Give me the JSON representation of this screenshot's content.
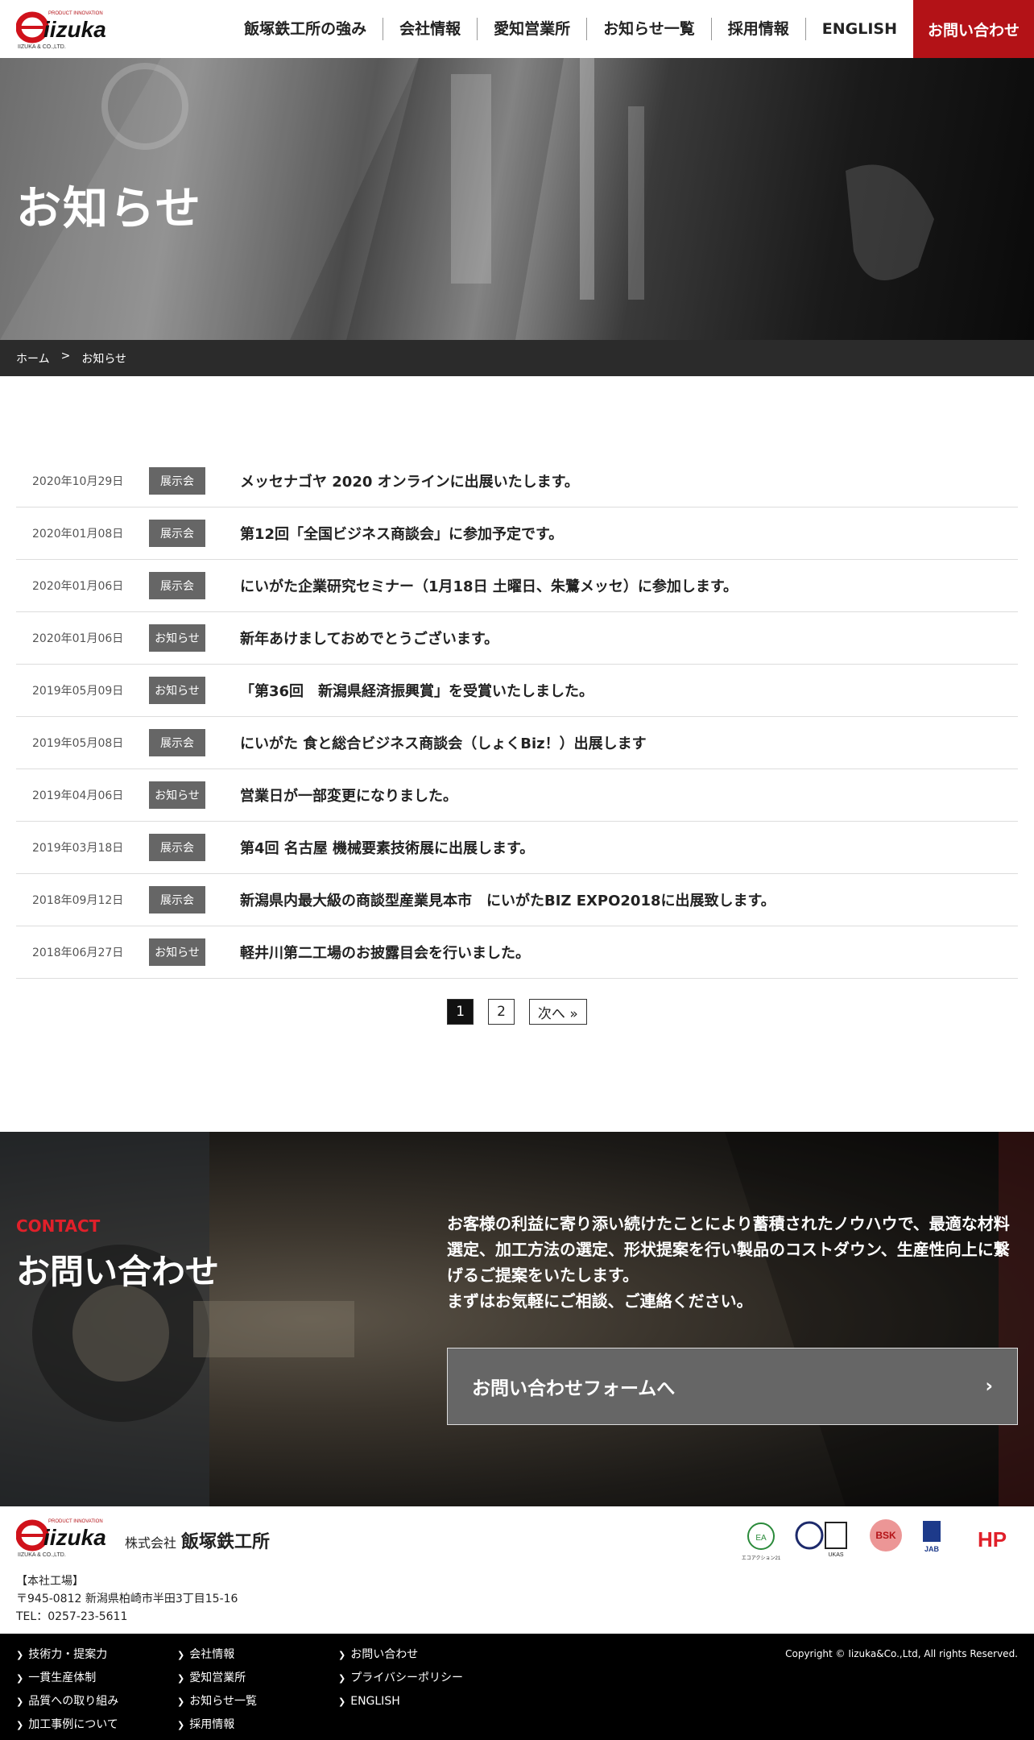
{
  "header": {
    "logo_tagline": "PRODUCT INNOVATION",
    "logo_word": "iizuka",
    "logo_sub": "IIZUKA & CO.,LTD.",
    "nav": [
      "飯塚鉄工所の強み",
      "会社情報",
      "愛知営業所",
      "お知らせ一覧",
      "採用情報",
      "ENGLISH"
    ],
    "contact": "お問い合わせ"
  },
  "hero": {
    "title": "お知らせ"
  },
  "breadcrumb": {
    "home": "ホーム",
    "sep": ">",
    "current": "お知らせ"
  },
  "news": [
    {
      "date": "2020年10月29日",
      "cat": "展示会",
      "title": "メッセナゴヤ 2020 オンラインに出展いたします。"
    },
    {
      "date": "2020年01月08日",
      "cat": "展示会",
      "title": "第12回「全国ビジネス商談会」に参加予定です。"
    },
    {
      "date": "2020年01月06日",
      "cat": "展示会",
      "title": "にいがた企業研究セミナー（1月18日 土曜日、朱鷺メッセ）に参加します。"
    },
    {
      "date": "2020年01月06日",
      "cat": "お知らせ",
      "title": "新年あけましておめでとうございます。"
    },
    {
      "date": "2019年05月09日",
      "cat": "お知らせ",
      "title": "「第36回　新潟県経済振興賞」を受賞いたしました。"
    },
    {
      "date": "2019年05月08日",
      "cat": "展示会",
      "title": "にいがた 食と総合ビジネス商談会（しょくBiz！）出展します"
    },
    {
      "date": "2019年04月06日",
      "cat": "お知らせ",
      "title": "営業日が一部変更になりました。"
    },
    {
      "date": "2019年03月18日",
      "cat": "展示会",
      "title": "第4回 名古屋 機械要素技術展に出展します。"
    },
    {
      "date": "2018年09月12日",
      "cat": "展示会",
      "title": "新潟県内最大級の商談型産業見本市　にいがたBIZ EXPO2018に出展致します。"
    },
    {
      "date": "2018年06月27日",
      "cat": "お知らせ",
      "title": "軽井川第二工場のお披露目会を行いました。"
    }
  ],
  "pager": {
    "current": "1",
    "page2": "2",
    "next": "次へ »"
  },
  "contact": {
    "label": "CONTACT",
    "title": "お問い合わせ",
    "text1": "お客様の利益に寄り添い続けたことにより蓄積されたノウハウで、最適な材料選定、加工方法の選定、形状提案を行い製品のコストダウン、生産性向上に繋げるご提案をいたします。",
    "text2": "まずはお気軽にご相談、ご連絡ください。",
    "button": "お問い合わせフォームへ",
    "button_arrow": "›"
  },
  "footer": {
    "company_prefix": "株式会社",
    "company_name": "飯塚鉄工所",
    "addr_label": "【本社工場】",
    "address": "〒945-0812 新潟県柏崎市半田3丁目15-16",
    "tel": "TEL：0257-23-5611",
    "col1": [
      "技術力・提案力",
      "一貫生産体制",
      "品質への取り組み",
      "加工事例について"
    ],
    "col2": [
      "会社情報",
      "愛知営業所",
      "お知らせ一覧",
      "採用情報"
    ],
    "col3": [
      "お問い合わせ",
      "プライバシーポリシー",
      "ENGLISH"
    ],
    "copyright": "Copyright © Iizuka&Co.,Ltd, All rights Reserved.",
    "cert1": "エコアクション21",
    "cert2": "UKAS",
    "cert3": "BSK",
    "cert4": "JAB",
    "cert5": "HP"
  },
  "colors": {
    "brand_red": "#b31217",
    "tag_gray": "#666666",
    "footer_black": "#000000"
  }
}
